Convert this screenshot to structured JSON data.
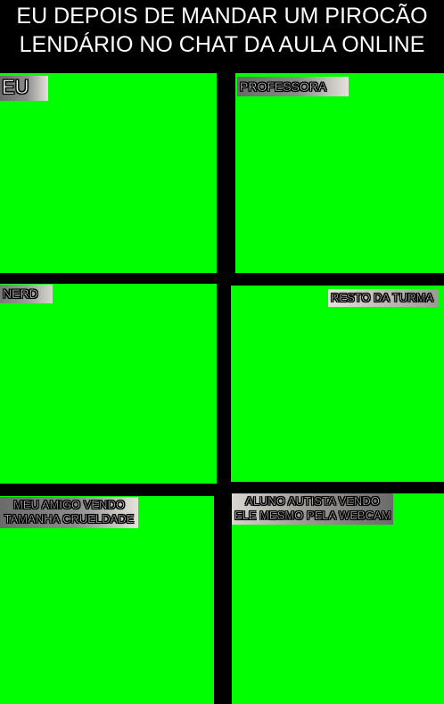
{
  "title": {
    "line1": "EU DEPOIS DE MANDAR UM PIROCÃO",
    "line2": "LENDÁRIO NO CHAT DA AULA ONLINE"
  },
  "panels": [
    {
      "label_lines": [
        "EU"
      ]
    },
    {
      "label_lines": [
        "PROFESSORA"
      ]
    },
    {
      "label_lines": [
        "NERD"
      ]
    },
    {
      "label_lines": [
        "RESTO DA TURMA"
      ]
    },
    {
      "label_lines": [
        "MEU AMIGO VENDO",
        "TAMANHA CRUELDADE"
      ]
    },
    {
      "label_lines": [
        "ALUNO AUTISTA VENDO",
        "ELE MESMO PELA WEBCAM"
      ]
    }
  ],
  "colors": {
    "background": "#000000",
    "panel": "#00ff00",
    "text": "#ffffff"
  }
}
